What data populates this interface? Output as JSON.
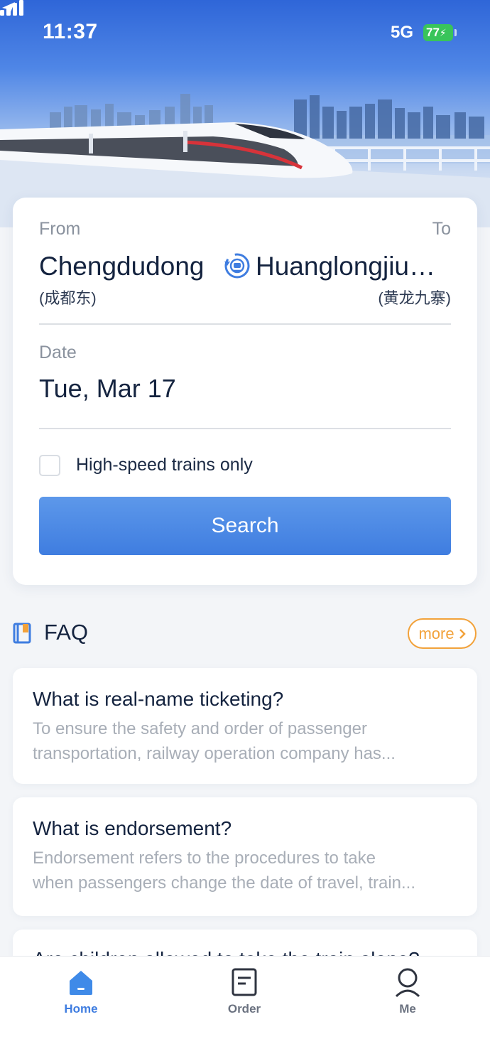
{
  "status_bar": {
    "time": "11:37",
    "network": "5G",
    "battery": "77"
  },
  "search_card": {
    "from_label": "From",
    "to_label": "To",
    "from_station": "Chengdudong",
    "from_station_cn": "(成都东)",
    "to_station": "Huanglongjiuzhaigou",
    "to_station_cn": "(黄龙九寨)",
    "date_label": "Date",
    "date_value": "Tue, Mar 17",
    "high_speed_label": "High-speed trains only",
    "high_speed_checked": false,
    "search_label": "Search"
  },
  "faq": {
    "title": "FAQ",
    "more_label": "more",
    "items": [
      {
        "question": "What is real-name ticketing?",
        "answer_line1": "To ensure the safety and order of passenger",
        "answer_line2": "transportation, railway operation company has..."
      },
      {
        "question": "What is endorsement?",
        "answer_line1": "Endorsement refers to the procedures to take",
        "answer_line2": "when passengers change the date of travel, train..."
      },
      {
        "question": "Are children allowed to take the train alone?"
      }
    ]
  },
  "tabbar": {
    "items": [
      {
        "label": "Home",
        "icon": "home-icon",
        "active": true
      },
      {
        "label": "Order",
        "icon": "order-icon",
        "active": false
      },
      {
        "label": "Me",
        "icon": "profile-icon",
        "active": false
      }
    ]
  },
  "colors": {
    "accent": "#3f7de0",
    "more": "#f2a23b",
    "inactive_tab": "#6b7280"
  }
}
